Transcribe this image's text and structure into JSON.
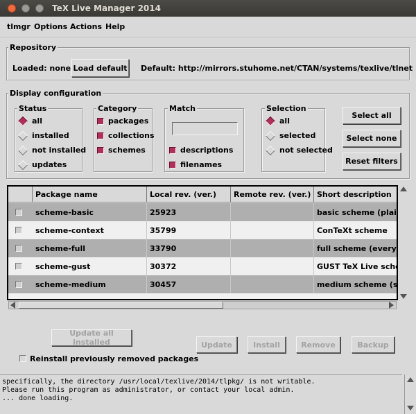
{
  "window": {
    "title": "TeX Live Manager 2014"
  },
  "menu": [
    "tlmgr",
    "Options",
    "Actions",
    "Help"
  ],
  "repository": {
    "legend": "Repository",
    "loaded_label": "Loaded: none",
    "load_default": "Load default",
    "default_label": "Default: http://mirrors.stuhome.net/CTAN/systems/texlive/tlnet"
  },
  "display": {
    "legend": "Display configuration",
    "status": {
      "title": "Status",
      "options": [
        "all",
        "installed",
        "not installed",
        "updates"
      ],
      "selected": "all"
    },
    "category": {
      "title": "Category",
      "options": [
        "packages",
        "collections",
        "schemes"
      ],
      "checked": [
        "packages",
        "collections",
        "schemes"
      ]
    },
    "match": {
      "title": "Match",
      "search_value": "",
      "options": [
        "descriptions",
        "filenames"
      ],
      "checked": [
        "descriptions",
        "filenames"
      ]
    },
    "selection": {
      "title": "Selection",
      "options": [
        "all",
        "selected",
        "not selected"
      ],
      "selected": "all"
    },
    "buttons": {
      "select_all": "Select all",
      "select_none": "Select none",
      "reset_filters": "Reset filters"
    }
  },
  "table": {
    "columns": [
      "Package name",
      "Local rev. (ver.)",
      "Remote rev. (ver.)",
      "Short description"
    ],
    "rows": [
      {
        "name": "scheme-basic",
        "local": "25923",
        "remote": "",
        "desc": "basic scheme (plain and"
      },
      {
        "name": "scheme-context",
        "local": "35799",
        "remote": "",
        "desc": "ConTeXt scheme"
      },
      {
        "name": "scheme-full",
        "local": "33790",
        "remote": "",
        "desc": "full scheme (everything"
      },
      {
        "name": "scheme-gust",
        "local": "30372",
        "remote": "",
        "desc": "GUST TeX Live scheme"
      },
      {
        "name": "scheme-medium",
        "local": "30457",
        "remote": "",
        "desc": "medium scheme (small"
      }
    ]
  },
  "actions": {
    "update_all": "Update all installed",
    "update": "Update",
    "install": "Install",
    "remove": "Remove",
    "backup": "Backup",
    "reinstall_label": "Reinstall previously removed packages"
  },
  "log": [
    "specifically, the directory /usr/local/texlive/2014/tlpkg/ is not writable.",
    "Please run this program as administrator, or contact your local admin.",
    "... done loading."
  ]
}
